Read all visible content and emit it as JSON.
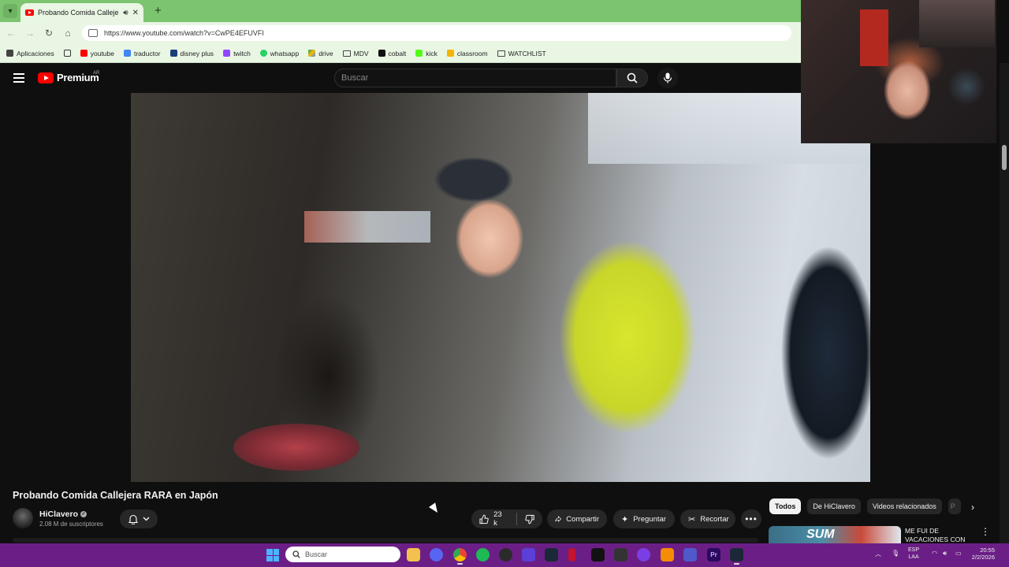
{
  "browser": {
    "tab": {
      "title": "Probando Comida Callejera"
    },
    "url": "https://www.youtube.com/watch?v=CwPE4EFUVFI",
    "bookmarks": [
      {
        "label": "Aplicaciones"
      },
      {
        "label": "youtube"
      },
      {
        "label": "traductor"
      },
      {
        "label": "disney plus"
      },
      {
        "label": "twitch"
      },
      {
        "label": "whatsapp"
      },
      {
        "label": "drive"
      },
      {
        "label": "MDV"
      },
      {
        "label": "cobalt"
      },
      {
        "label": "kick"
      },
      {
        "label": "classroom"
      },
      {
        "label": "WATCHLIST"
      }
    ]
  },
  "youtube": {
    "logo_text": "Premium",
    "country_code": "AR",
    "search_placeholder": "Buscar",
    "video": {
      "title": "Probando Comida Callejera RARA en Japón",
      "channel": "HiClavero",
      "subscribers": "2.08 M de suscriptores",
      "likes": "23 k",
      "share_label": "Compartir",
      "ask_label": "Preguntar",
      "clip_label": "Recortar"
    },
    "chips": [
      "Todos",
      "De HiClavero",
      "Videos relacionados",
      "P"
    ],
    "related": {
      "title": "ME FUI DE VACACIONES CON",
      "thumb_text": "SUM"
    }
  },
  "taskbar": {
    "search_placeholder": "Buscar",
    "language": [
      "ESP",
      "LAA"
    ],
    "time": "20:55",
    "date": "2/2/2026"
  },
  "colors": {
    "browser_theme": "#7cc46f",
    "youtube_red": "#ff0000",
    "taskbar": "#6b1f86",
    "page_bg": "#0f0f0f"
  }
}
